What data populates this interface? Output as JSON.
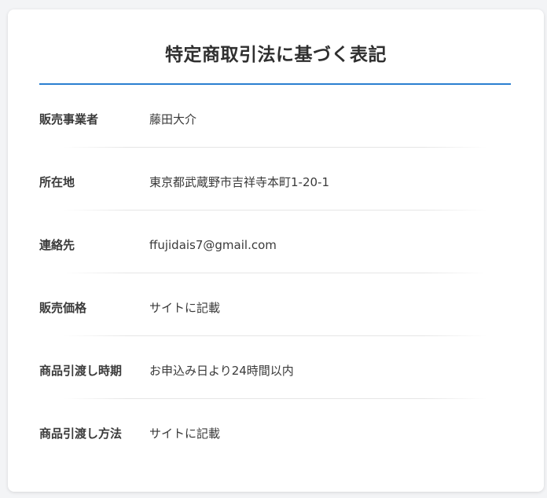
{
  "page": {
    "title": "特定商取引法に基づく表記",
    "accent_color": "#2a7fd0"
  },
  "rows": [
    {
      "label": "販売事業者",
      "value": "藤田大介"
    },
    {
      "label": "所在地",
      "value": "東京都武蔵野市吉祥寺本町1-20-1"
    },
    {
      "label": "連絡先",
      "value": "ffujidais7@gmail.com"
    },
    {
      "label": "販売価格",
      "value": "サイトに記載"
    },
    {
      "label": "商品引渡し時期",
      "value": "お申込み日より24時間以内"
    },
    {
      "label": "商品引渡し方法",
      "value": "サイトに記載"
    }
  ]
}
